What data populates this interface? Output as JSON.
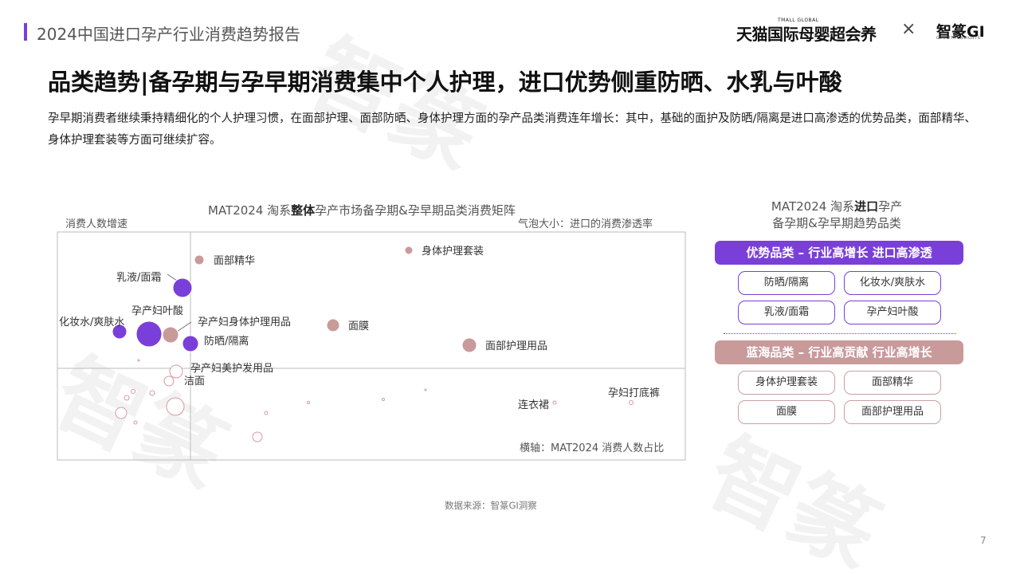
{
  "header": {
    "report_title": "2024中国进口孕产行业消费趋势报告",
    "logo_tmall_small": "TMALL GLOBAL",
    "logo_tmall": "天猫国际母婴超会养",
    "logo_x": "×",
    "logo_zc": "智篆GI",
    "logo_zc_sub": "GROWTH INSIGHTS"
  },
  "main_title": "品类趋势|备孕期与孕早期消费集中个人护理，进口优势侧重防晒、水乳与叶酸",
  "description": "孕早期消费者继续秉持精细化的个人护理习惯，在面部护理、面部防晒、身体护理方面的孕产品类消费连年增长：其中，基础的面护及防晒/隔离是进口高渗透的优势品类，面部精华、身体护理套装等方面可继续扩容。",
  "chart_data": {
    "type": "scatter",
    "title_pre": "MAT2024 淘系",
    "title_bold": "整体",
    "title_post": "孕产市场备孕期&孕早期品类消费矩阵",
    "ylabel": "消费人数增速",
    "xlabel": "横轴：MAT2024 消费人数占比",
    "bubble_note": "气泡大小：进口的消费渗透率",
    "points": [
      {
        "label": "面部精华",
        "kind": "pink-filled"
      },
      {
        "label": "身体护理套装",
        "kind": "pink-filled"
      },
      {
        "label": "乳液/面霜",
        "kind": "purple"
      },
      {
        "label": "孕产妇叶酸",
        "kind": "purple"
      },
      {
        "label": "化妆水/爽肤水",
        "kind": "purple"
      },
      {
        "label": "孕产妇身体护理用品",
        "kind": "pink-filled"
      },
      {
        "label": "防晒/隔离",
        "kind": "purple"
      },
      {
        "label": "面膜",
        "kind": "pink-filled"
      },
      {
        "label": "面部护理用品",
        "kind": "pink-filled"
      },
      {
        "label": "孕产妇美护发用品",
        "kind": "pink-hollow"
      },
      {
        "label": "洁面",
        "kind": "pink-hollow"
      },
      {
        "label": "连衣裙",
        "kind": "pink-hollow"
      },
      {
        "label": "孕妇打底裤",
        "kind": "pink-hollow"
      }
    ]
  },
  "sidebar": {
    "title_pre": "MAT2024 淘系",
    "title_bold": "进口",
    "title_post": "孕产",
    "title_line2": "备孕期&孕早期趋势品类",
    "advantage_label": "优势品类 – 行业高增长 进口高渗透",
    "advantage_items": [
      "防晒/隔离",
      "化妆水/爽肤水",
      "乳液/面霜",
      "孕产妇叶酸"
    ],
    "blueocean_label": "蓝海品类 – 行业高贡献 行业高增长",
    "blueocean_items": [
      "身体护理套装",
      "面部精华",
      "面膜",
      "面部护理用品"
    ]
  },
  "source": "数据来源：智篆GI洞察",
  "page_number": "7",
  "colors": {
    "purple": "#7a3fd8",
    "pink": "#c99a9a",
    "accent_bar": "#7a3fd8"
  }
}
